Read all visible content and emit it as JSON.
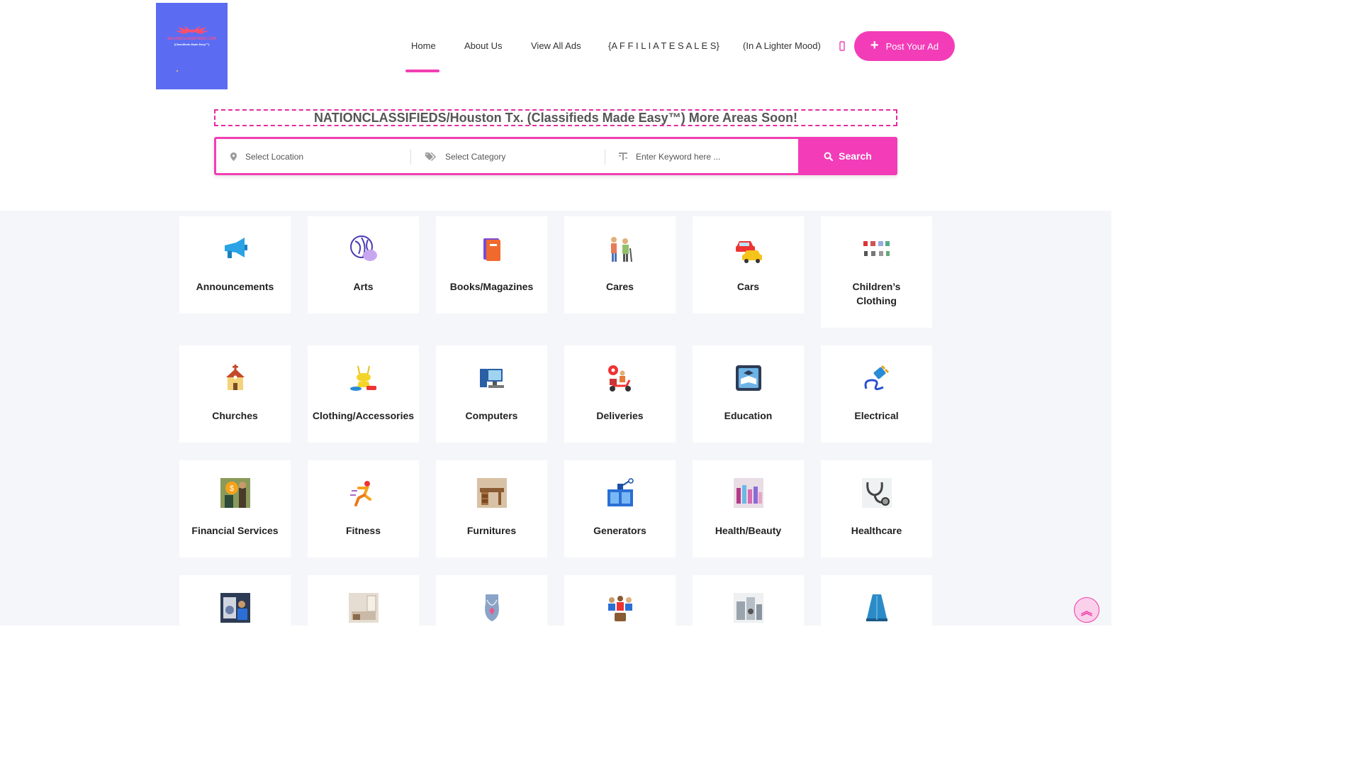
{
  "logo": {
    "line1": "MAJORCLASSIFIEDS.COM",
    "line2": "(Classifieds Made Easy™)"
  },
  "nav": [
    {
      "label": "Home"
    },
    {
      "label": "About Us"
    },
    {
      "label": "View All Ads"
    },
    {
      "label": "{A F F I L I A T E S A L E S}"
    },
    {
      "label": "(In A Lighter Mood)"
    }
  ],
  "post_ad_label": "Post Your Ad",
  "headline": "NATIONCLASSIFIEDS/Houston Tx. (Classifieds Made Easy™) More Areas Soon!",
  "search": {
    "location_placeholder": "Select Location",
    "category_placeholder": "Select Category",
    "keyword_placeholder": "Enter Keyword here ...",
    "button_label": "Search"
  },
  "categories": [
    {
      "label": "Announcements",
      "icon": "megaphone-icon"
    },
    {
      "label": "Arts",
      "icon": "palette-icon"
    },
    {
      "label": "Books/Magazines",
      "icon": "book-icon"
    },
    {
      "label": "Cares",
      "icon": "caregiver-icon"
    },
    {
      "label": "Cars",
      "icon": "cars-icon"
    },
    {
      "label": "Children’s Clothing",
      "icon": "kids-clothes-icon"
    },
    {
      "label": "Churches",
      "icon": "church-icon"
    },
    {
      "label": "Clothing/Accessories",
      "icon": "clothing-icon"
    },
    {
      "label": "Computers",
      "icon": "computer-icon"
    },
    {
      "label": "Deliveries",
      "icon": "delivery-scooter-icon"
    },
    {
      "label": "Education",
      "icon": "education-icon"
    },
    {
      "label": "Electrical",
      "icon": "plug-icon"
    },
    {
      "label": "Financial Services",
      "icon": "finance-icon"
    },
    {
      "label": "Fitness",
      "icon": "runner-icon"
    },
    {
      "label": "Furnitures",
      "icon": "desk-icon"
    },
    {
      "label": "Generators",
      "icon": "generator-icon"
    },
    {
      "label": "Health/Beauty",
      "icon": "beauty-icon"
    },
    {
      "label": "Healthcare",
      "icon": "stethoscope-icon"
    },
    {
      "label": "",
      "icon": "appliance-repair-icon"
    },
    {
      "label": "",
      "icon": "room-icon"
    },
    {
      "label": "",
      "icon": "necklace-icon"
    },
    {
      "label": "",
      "icon": "people-icon"
    },
    {
      "label": "",
      "icon": "machines-icon"
    },
    {
      "label": "",
      "icon": "dress-icon"
    }
  ],
  "colors": {
    "accent": "#f33cb8",
    "logo_bg": "#5b6cf2",
    "grid_bg": "#f5f6fa"
  }
}
